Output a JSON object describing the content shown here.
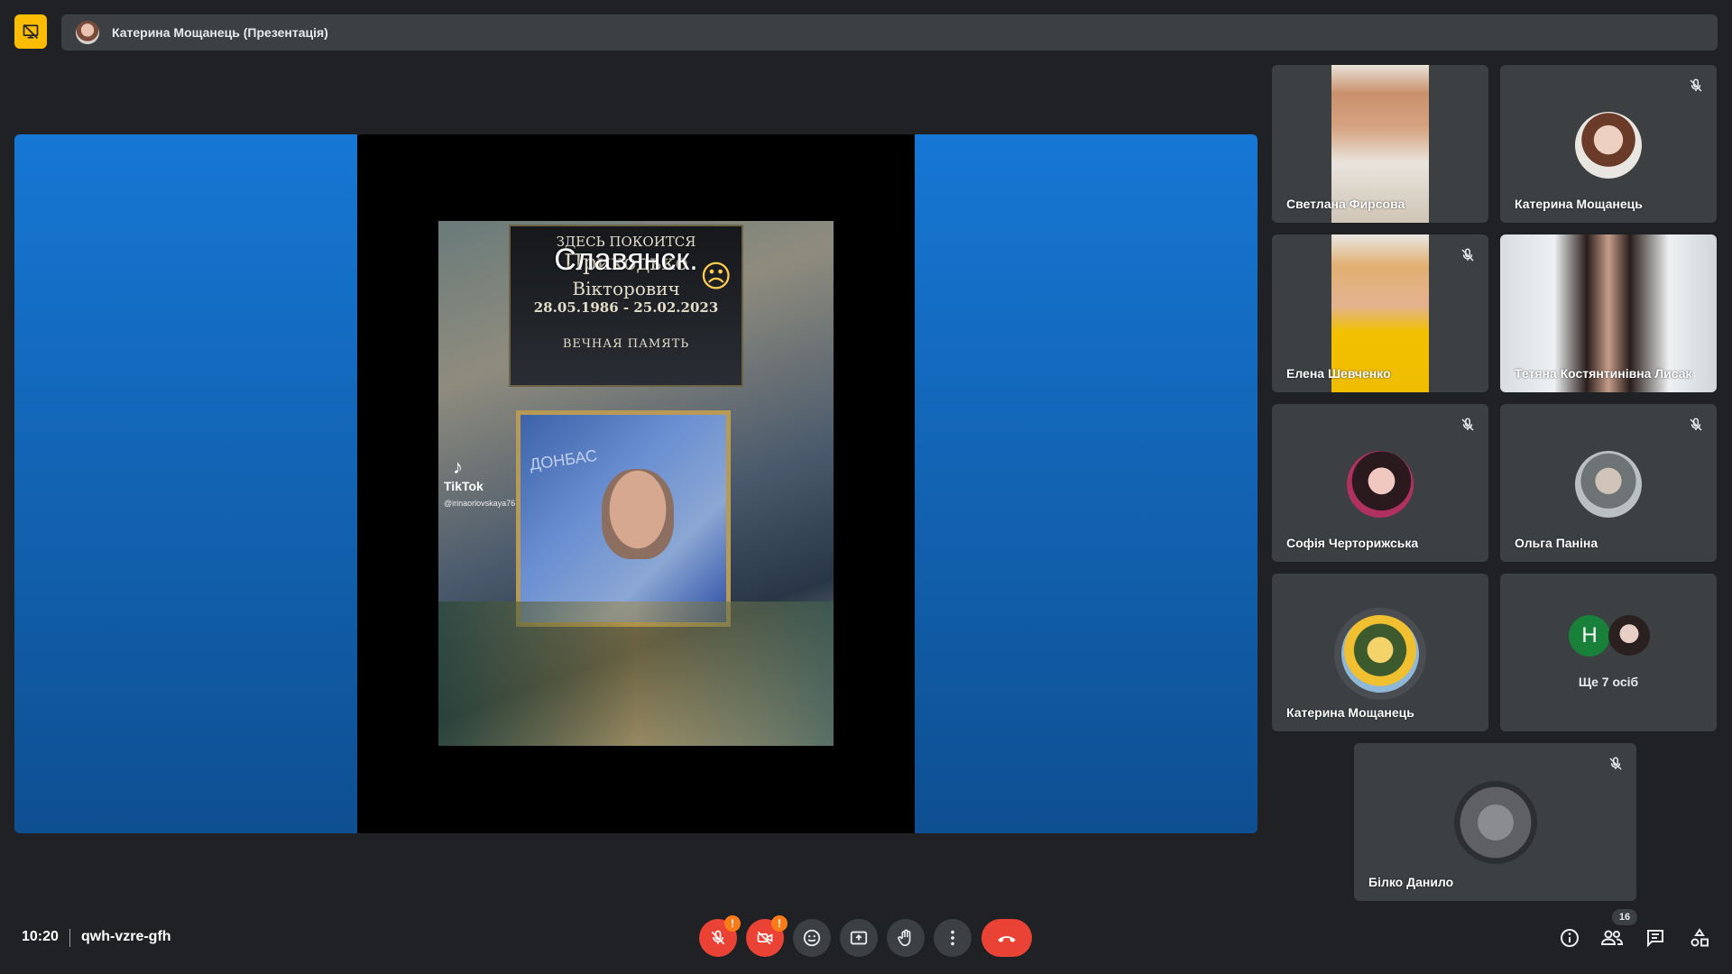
{
  "presentation": {
    "banner_text": "Катерина Мощанець (Презентація)"
  },
  "shared_content": {
    "plaque_line1": "ЗДЕСЬ ПОКОИТСЯ",
    "plaque_line2": "Приходько",
    "overlay_text": "Славянск.",
    "plaque_line3": "Вікторович",
    "plaque_dates": "28.05.1986 - 25.02.2023",
    "plaque_line4": "ВЕЧНАЯ ПАМЯТЬ",
    "portrait_text": "ДОНБАС",
    "tiktok_label": "TikTok",
    "tiktok_handle": "@irinaorlovskaya76"
  },
  "participants": [
    {
      "name": "Светлана Фирсова",
      "muted": false,
      "type": "video"
    },
    {
      "name": "Катерина Мощанець",
      "muted": true,
      "type": "avatar"
    },
    {
      "name": "Елена Шевченко",
      "muted": true,
      "type": "video"
    },
    {
      "name": "Тетяна Костянтинівна Лисак",
      "muted": false,
      "type": "video"
    },
    {
      "name": "Софія Черторижська",
      "muted": true,
      "type": "avatar"
    },
    {
      "name": "Ольга Паніна",
      "muted": true,
      "type": "avatar"
    },
    {
      "name": "Катерина Мощанець",
      "muted": false,
      "type": "avatar"
    },
    {
      "name": "Білко Данило",
      "muted": true,
      "type": "avatar"
    }
  ],
  "more_participants": {
    "initial": "Н",
    "label": "Ще 7 осіб"
  },
  "meeting": {
    "time": "10:20",
    "code": "qwh-vzre-gfh",
    "participant_count": "16"
  },
  "colors": {
    "background": "#202124",
    "tile": "#3c4043",
    "accent_yellow": "#fbbc04",
    "danger": "#ea4335",
    "warning": "#fa7b17"
  }
}
